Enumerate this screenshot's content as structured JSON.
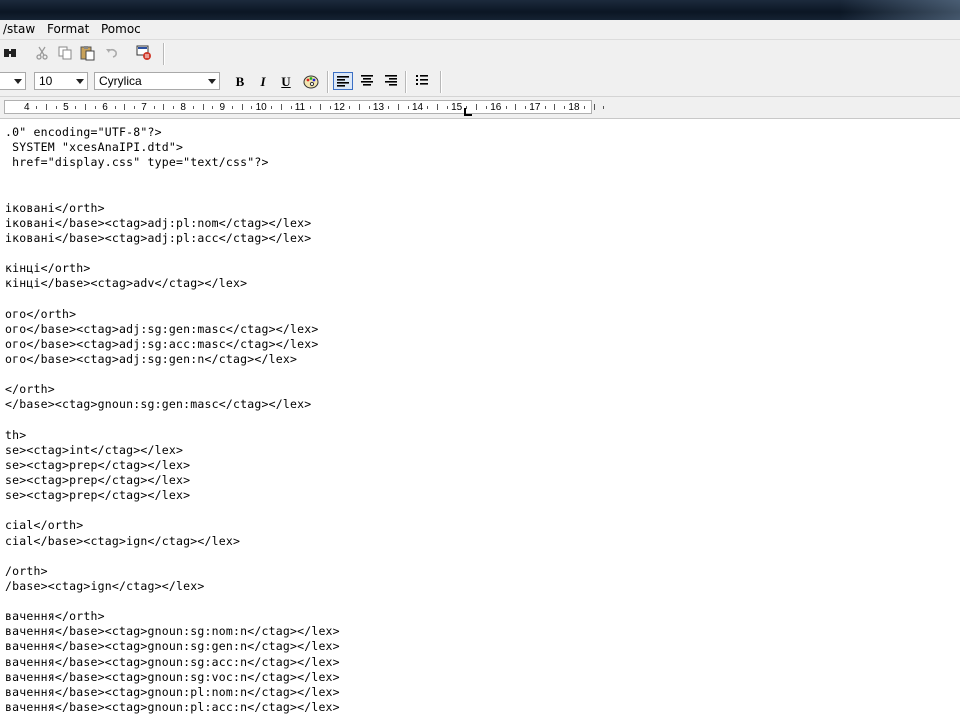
{
  "menu": {
    "items": [
      "/staw",
      "Format",
      "Pomoc"
    ]
  },
  "format_bar": {
    "style_value": "",
    "size_value": "10",
    "script_value": "Cyrylica",
    "bold_label": "B",
    "italic_label": "I",
    "underline_label": "U"
  },
  "ruler": {
    "labels": [
      "4",
      "5",
      "6",
      "7",
      "8",
      "9",
      "10",
      "11",
      "12",
      "13",
      "14",
      "15",
      "16",
      "17",
      "18"
    ]
  },
  "document": {
    "lines": [
      ".0\" encoding=\"UTF-8\"?>",
      " SYSTEM \"xcesAnaIPI.dtd\">",
      " href=\"display.css\" type=\"text/css\"?>",
      "",
      "",
      "ікованi</orth>",
      "ікованi</base><ctag>adj:pl:nom</ctag></lex>",
      "ікованi</base><ctag>adj:pl:acc</ctag></lex>",
      "",
      "кінці</orth>",
      "кінці</base><ctag>adv</ctag></lex>",
      "",
      "ого</orth>",
      "ого</base><ctag>adj:sg:gen:masc</ctag></lex>",
      "ого</base><ctag>adj:sg:acc:masc</ctag></lex>",
      "ого</base><ctag>adj:sg:gen:n</ctag></lex>",
      "",
      "</orth>",
      "</base><ctag>gnoun:sg:gen:masc</ctag></lex>",
      "",
      "th>",
      "se><ctag>int</ctag></lex>",
      "se><ctag>prep</ctag></lex>",
      "se><ctag>prep</ctag></lex>",
      "se><ctag>prep</ctag></lex>",
      "",
      "cial</orth>",
      "cial</base><ctag>ign</ctag></lex>",
      "",
      "/orth>",
      "/base><ctag>ign</ctag></lex>",
      "",
      "вачення</orth>",
      "вачення</base><ctag>gnoun:sg:nom:n</ctag></lex>",
      "вачення</base><ctag>gnoun:sg:gen:n</ctag></lex>",
      "вачення</base><ctag>gnoun:sg:acc:n</ctag></lex>",
      "вачення</base><ctag>gnoun:sg:voc:n</ctag></lex>",
      "вачення</base><ctag>gnoun:pl:nom:n</ctag></lex>",
      "вачення</base><ctag>gnoun:pl:acc:n</ctag></lex>"
    ]
  }
}
